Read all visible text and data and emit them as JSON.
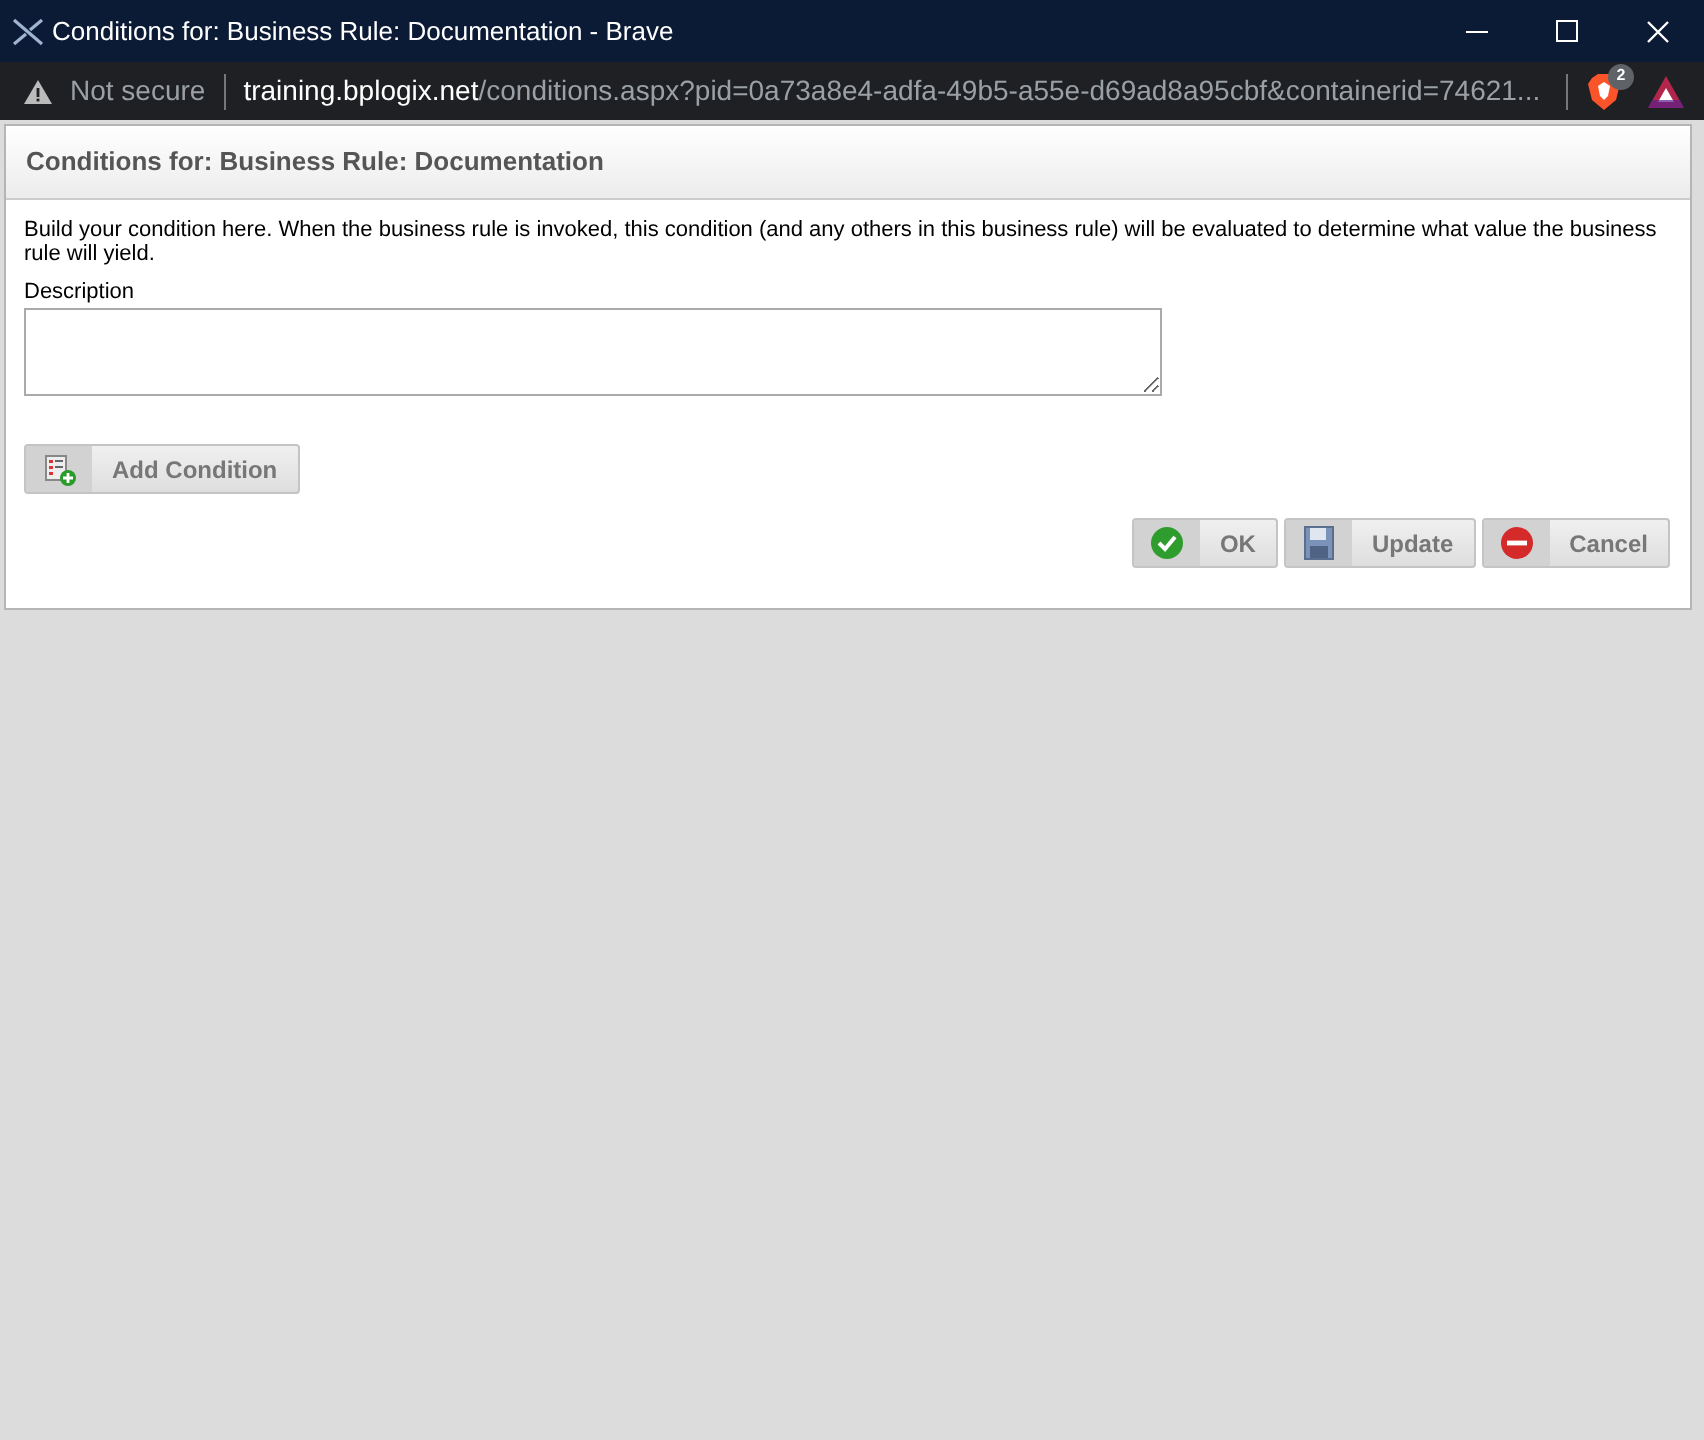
{
  "window": {
    "title": "Conditions for: Business Rule: Documentation - Brave"
  },
  "address_bar": {
    "security": "Not secure",
    "host": "training.bplogix.net",
    "path": "/conditions.aspx?pid=0a73a8e4-adfa-49b5-a55e-d69ad8a95cbf&containerid=74621...",
    "shields_count": "2"
  },
  "dialog": {
    "title": "Conditions for: Business Rule: Documentation",
    "intro": "Build your condition here. When the business rule is invoked, this condition (and any others in this business rule) will be evaluated to determine what value the business rule will yield.",
    "description": {
      "label": "Description"
    },
    "add_button": {
      "label": "Add Condition",
      "kind": "add"
    },
    "buttons": [
      {
        "label": "OK",
        "kind": "ok"
      },
      {
        "label": "Update",
        "kind": "update"
      },
      {
        "label": "Cancel",
        "kind": "cancel"
      }
    ]
  }
}
